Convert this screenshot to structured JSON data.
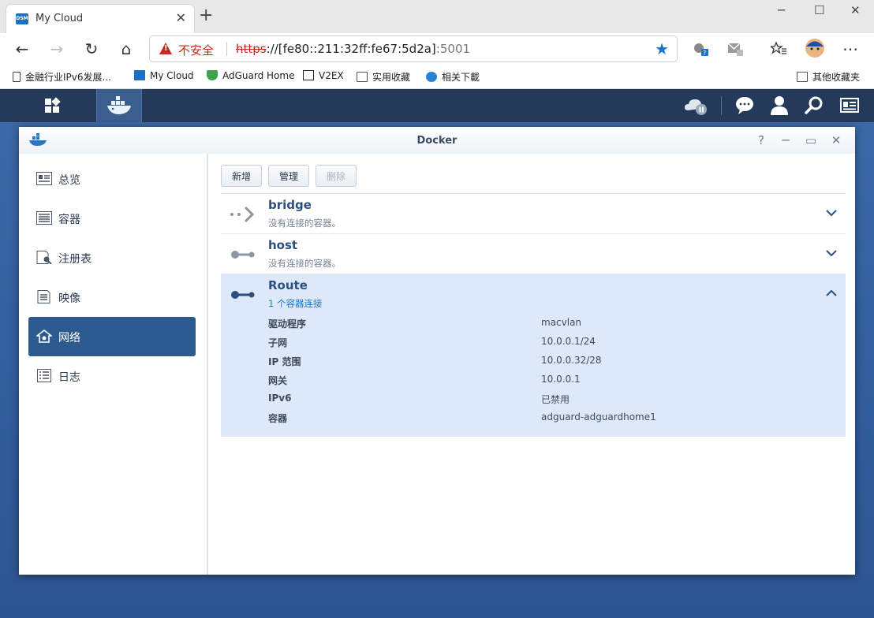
{
  "browser": {
    "tab_title": "My Cloud",
    "tab_favicon": "DSM",
    "address_insecure_label": "不安全",
    "address_protocol": "https",
    "address_host": "://[fe80::211:32ff:fe67:5d2a]",
    "address_port": ":5001",
    "bookmarks": [
      "金融行业IPv6发展...",
      "My Cloud",
      "AdGuard Home",
      "V2EX",
      "实用收藏",
      "相关下載"
    ],
    "other_bookmarks": "其他收藏夹",
    "colors": {
      "insecure": "#c42b1c",
      "accent": "#1a73c8"
    }
  },
  "window": {
    "title": "Docker"
  },
  "sidebar": {
    "items": [
      {
        "label": "总览",
        "icon": "overview-icon"
      },
      {
        "label": "容器",
        "icon": "container-icon"
      },
      {
        "label": "注册表",
        "icon": "registry-icon"
      },
      {
        "label": "映像",
        "icon": "image-icon"
      },
      {
        "label": "网络",
        "icon": "network-icon",
        "active": true
      },
      {
        "label": "日志",
        "icon": "log-icon"
      }
    ]
  },
  "toolbar": {
    "add_label": "新增",
    "manage_label": "管理",
    "delete_label": "删除"
  },
  "networks": [
    {
      "name": "bridge",
      "sub": "没有连接的容器。"
    },
    {
      "name": "host",
      "sub": "没有连接的容器。"
    },
    {
      "name": "Route",
      "sub": "1 个容器连接",
      "expanded": true,
      "details": [
        {
          "key": "驱动程序",
          "value": "macvlan"
        },
        {
          "key": "子网",
          "value": "10.0.0.1/24"
        },
        {
          "key": "IP 范围",
          "value": "10.0.0.32/28"
        },
        {
          "key": "网关",
          "value": "10.0.0.1"
        },
        {
          "key": "IPv6",
          "value": "已禁用"
        },
        {
          "key": "容器",
          "value": "adguard-adguardhome1"
        }
      ]
    }
  ]
}
